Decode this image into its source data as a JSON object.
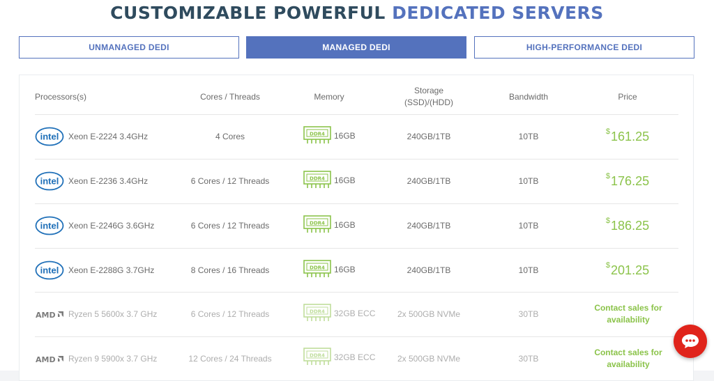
{
  "title": {
    "main": "CUSTOMIZABLE POWERFUL",
    "accent": "DEDICATED SERVERS"
  },
  "tabs": [
    {
      "label": "UNMANAGED DEDI",
      "active": false
    },
    {
      "label": "MANAGED DEDI",
      "active": true
    },
    {
      "label": "HIGH-PERFORMANCE DEDI",
      "active": false
    }
  ],
  "columns": {
    "processors": "Processors(s)",
    "cores": "Cores / Threads",
    "memory": "Memory",
    "storage_line1": "Storage",
    "storage_line2": "(SSD)/(HDD)",
    "bandwidth": "Bandwidth",
    "price": "Price"
  },
  "rows": [
    {
      "brand": "intel",
      "processor": "Xeon E-2224 3.4GHz",
      "cores": "4 Cores",
      "memory_badge": "DDR4",
      "memory": "16GB",
      "storage": "240GB/1TB",
      "bandwidth": "10TB",
      "currency": "$",
      "price": "161.25"
    },
    {
      "brand": "intel",
      "processor": "Xeon E-2236 3.4GHz",
      "cores": "6 Cores / 12 Threads",
      "memory_badge": "DDR4",
      "memory": "16GB",
      "storage": "240GB/1TB",
      "bandwidth": "10TB",
      "currency": "$",
      "price": "176.25"
    },
    {
      "brand": "intel",
      "processor": "Xeon E-2246G 3.6GHz",
      "cores": "6 Cores / 12 Threads",
      "memory_badge": "DDR4",
      "memory": "16GB",
      "storage": "240GB/1TB",
      "bandwidth": "10TB",
      "currency": "$",
      "price": "186.25"
    },
    {
      "brand": "intel",
      "processor": "Xeon E-2288G 3.7GHz",
      "cores": "8 Cores / 16 Threads",
      "memory_badge": "DDR4",
      "memory": "16GB",
      "storage": "240GB/1TB",
      "bandwidth": "10TB",
      "currency": "$",
      "price": "201.25"
    },
    {
      "brand": "AMD",
      "processor": "Ryzen 5 5600x 3.7 GHz",
      "cores": "6 Cores / 12 Threads",
      "memory_badge": "DDR4",
      "memory": "32GB ECC",
      "storage": "2x 500GB NVMe",
      "bandwidth": "30TB",
      "contact_line1": "Contact sales for",
      "contact_line2": "availability"
    },
    {
      "brand": "AMD",
      "processor": "Ryzen 9 5900x 3.7 GHz",
      "cores": "12 Cores / 24 Threads",
      "memory_badge": "DDR4",
      "memory": "32GB ECC",
      "storage": "2x 500GB NVMe",
      "bandwidth": "30TB",
      "contact_line1": "Contact sales for",
      "contact_line2": "availability"
    }
  ],
  "colors": {
    "accent": "#5472bd",
    "heading": "#2f4b5e",
    "price": "#8bc34a",
    "intel": "#1e6fb8",
    "chat": "#e0241b"
  },
  "icons": {
    "intel": "intel-logo",
    "amd": "amd-logo",
    "memory": "ram-module-icon",
    "chat": "chat-bubble-icon"
  }
}
